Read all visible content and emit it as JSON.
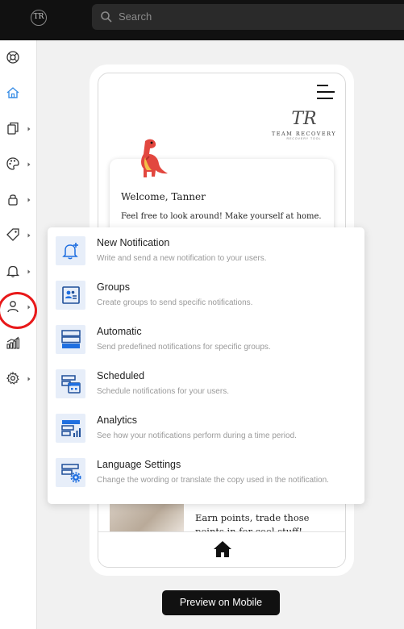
{
  "topbar": {
    "logo_text": "TR",
    "search": {
      "placeholder": "Search"
    }
  },
  "sidebar": {
    "items": [
      {
        "icon": "lifebuoy-icon",
        "has_submenu": false
      },
      {
        "icon": "home-icon",
        "has_submenu": false,
        "active": true
      },
      {
        "icon": "pages-icon",
        "has_submenu": true
      },
      {
        "icon": "palette-icon",
        "has_submenu": true
      },
      {
        "icon": "lock-icon",
        "has_submenu": true
      },
      {
        "icon": "tag-icon",
        "has_submenu": true
      },
      {
        "icon": "bell-icon",
        "has_submenu": true,
        "highlighted": true
      },
      {
        "icon": "user-icon",
        "has_submenu": true
      },
      {
        "icon": "analytics-icon",
        "has_submenu": false
      },
      {
        "icon": "gear-icon",
        "has_submenu": true
      }
    ]
  },
  "preview": {
    "brand_monogram": "TR",
    "brand_name": "TEAM RECOVERY",
    "brand_sub": "RECOVERY TOOL",
    "welcome": "Welcome, Tanner",
    "message": "Feel free to look around! Make yourself at home.",
    "promo": "Earn points, trade those points in for cool stuff!",
    "button_label": "Preview on Mobile"
  },
  "notification_menu": {
    "items": [
      {
        "title": "New Notification",
        "description": "Write and send a new notification to your users.",
        "icon": "bell-plus-icon"
      },
      {
        "title": "Groups",
        "description": "Create groups to send specific notifications.",
        "icon": "groups-icon"
      },
      {
        "title": "Automatic",
        "description": "Send predefined notifications for specific groups.",
        "icon": "automatic-icon"
      },
      {
        "title": "Scheduled",
        "description": "Schedule notifications for your users.",
        "icon": "calendar-icon"
      },
      {
        "title": "Analytics",
        "description": "See how your notifications perform during a time period.",
        "icon": "analytics-chart-icon"
      },
      {
        "title": "Language Settings",
        "description": "Change the wording or translate the copy used in the notification.",
        "icon": "language-settings-icon"
      }
    ]
  },
  "colors": {
    "accent": "#1f6fe0",
    "tile_bg": "#e7eef9",
    "highlight_circle": "#e8191a",
    "topbar": "#111111"
  }
}
